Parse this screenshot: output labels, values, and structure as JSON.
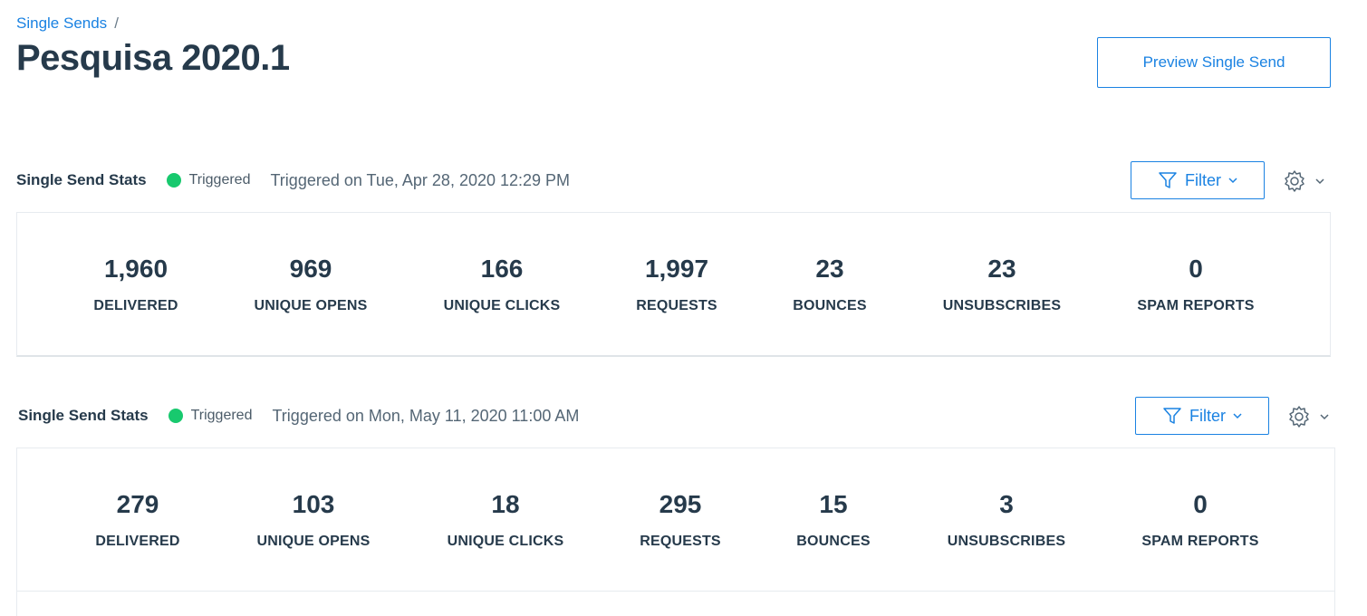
{
  "breadcrumb": {
    "link": "Single Sends",
    "separator": "/"
  },
  "page_title": "Pesquisa 2020.1",
  "preview_button": "Preview Single Send",
  "sections": [
    {
      "title": "Single Send Stats",
      "status": "Triggered",
      "triggered_on": "Triggered on Tue, Apr 28, 2020 12:29 PM",
      "filter_label": "Filter",
      "stats": [
        {
          "value": "1,960",
          "label": "DELIVERED"
        },
        {
          "value": "969",
          "label": "UNIQUE OPENS"
        },
        {
          "value": "166",
          "label": "UNIQUE CLICKS"
        },
        {
          "value": "1,997",
          "label": "REQUESTS"
        },
        {
          "value": "23",
          "label": "BOUNCES"
        },
        {
          "value": "23",
          "label": "UNSUBSCRIBES"
        },
        {
          "value": "0",
          "label": "SPAM REPORTS"
        }
      ]
    },
    {
      "title": "Single Send Stats",
      "status": "Triggered",
      "triggered_on": "Triggered on Mon, May 11, 2020 11:00 AM",
      "filter_label": "Filter",
      "stats": [
        {
          "value": "279",
          "label": "DELIVERED"
        },
        {
          "value": "103",
          "label": "UNIQUE OPENS"
        },
        {
          "value": "18",
          "label": "UNIQUE CLICKS"
        },
        {
          "value": "295",
          "label": "REQUESTS"
        },
        {
          "value": "15",
          "label": "BOUNCES"
        },
        {
          "value": "3",
          "label": "UNSUBSCRIBES"
        },
        {
          "value": "0",
          "label": "SPAM REPORTS"
        }
      ]
    }
  ],
  "colors": {
    "accent": "#1a82e2",
    "status_triggered": "#18c96e",
    "text": "#263a4b"
  },
  "icons": {
    "filter": "filter-funnel-icon",
    "gear": "gear-icon",
    "chevron": "chevron-down-icon"
  }
}
